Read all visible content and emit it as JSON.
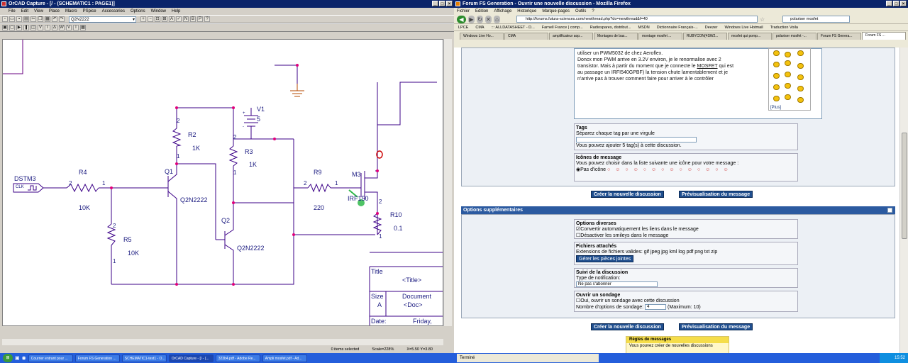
{
  "orcad": {
    "title": "OrCAD Capture - [/ - (SCHEMATIC1 : PAGE1)]",
    "menu": [
      "File",
      "Edit",
      "View",
      "Place",
      "Macro",
      "PSpice",
      "Accessories",
      "Options",
      "Window",
      "Help"
    ],
    "part_selector": "Q2N2222",
    "status": {
      "items": "0 items selected",
      "scale": "Scale=228%",
      "coords": "X=5.50  Y=3.80"
    },
    "schematic": {
      "labels": {
        "dstm3": "DSTM3",
        "clk": "CLK",
        "r4": "R4",
        "r4_val": "10K",
        "r5": "R5",
        "r5_val": "10K",
        "r2": "R2",
        "r2_val": "1K",
        "r3": "R3",
        "r3_val": "1K",
        "r9": "R9",
        "r9_val": "220",
        "r10": "R10",
        "r10_val": "0.1",
        "q1": "Q1",
        "q1_part": "Q2N2222",
        "q2": "Q2",
        "q2_part": "Q2N2222",
        "m3": "M3",
        "m3_part": "IRF150",
        "v1": "V1",
        "v1_val": "5",
        "pin1": "1",
        "pin2": "2",
        "plus": "+",
        "minus": "-"
      },
      "titleblock": {
        "title_label": "Title",
        "title_val": "<Title>",
        "size_label": "Size",
        "size_val": "A",
        "doc_label": "Document",
        "doc_val": "<Doc>",
        "date_label": "Date:",
        "date_val": "Friday,"
      }
    }
  },
  "firefox": {
    "title": "Forum FS Generation - Ouvrir une nouvelle discussion - Mozilla Firefox",
    "menu": [
      "Fichier",
      "Edition",
      "Affichage",
      "Historique",
      "Marque-pages",
      "Outils",
      "?"
    ],
    "url": "http://forums.futura-sciences.com/newthread.php?do=newthread&f=40",
    "search": "polariser mosfet",
    "bookmarks": [
      "LPCE",
      "CMA",
      "::: ALLDATASHEET - D...",
      "Farnell France | comp...",
      "Radiospares, distribut...",
      "MSDN",
      "Dictionnaire Français-...",
      "Deezer",
      "Windows Live Hotmail",
      "Traduction Voila"
    ],
    "tabs": [
      "Windows Live Ho...",
      "CMA",
      "amplificateur aop...",
      "Montages de bas...",
      "montage mosfet ...",
      "RUBYCON(4SW2...",
      "mosfet qui pomp...",
      "polariser mosfet -...",
      "Forum FS Genera...",
      "Forum FS ..."
    ],
    "message": {
      "line1": "utiliser un PWM5032 de chez Aeroflex.",
      "line2": "Doncx mon PWM arrive en 3.2V environ, je le renormalise avec 2",
      "line3": "transistor. Mais à partir du moment que je connecte le",
      "mosfet": "MOSFET",
      "line3b": " qui est",
      "line4": "au passage un IRFI540GPBF) la tension chute lamentablement et je",
      "line5": "n'arrive pas à trouver comment faire pour arriver à le contrôler"
    },
    "smilies_more": "[Plus]",
    "tags": {
      "legend": "Tags",
      "hint": "Séparez chaque tag par une virgule",
      "note": "Vous pouvez ajouter 5 tag(s) à cette discussion."
    },
    "icons": {
      "legend": "Icônes de message",
      "hint": "Vous pouvez choisir dans la liste suivante une icône pour votre message :",
      "none": "Pas d'icône"
    },
    "btn_create": "Créer la nouvelle discussion",
    "btn_preview": "Prévisualisation du message",
    "options_header": "Options supplémentaires",
    "diverses": {
      "legend": "Options diverses",
      "opt1": "Convertir automatiquement les liens dans le message",
      "opt2": "Désactiver les smileys dans le message"
    },
    "attach": {
      "legend": "Fichiers attachés",
      "ext": "Extensions de fichiers valides: gif jpeg jpg kml log pdf png txt zip",
      "btn": "Gérer les pièces jointes"
    },
    "suivi": {
      "legend": "Suivi de la discussion",
      "type": "Type de notification:",
      "select": "Ne pas s'abonner"
    },
    "sondage": {
      "legend": "Ouvrir un sondage",
      "opt": "Oui, ouvrir un sondage avec cette discussion",
      "count_label": "Nombre d'options de sondage:",
      "count": "4",
      "max": "(Maximum: 10)"
    },
    "rules": {
      "header": "Règles de messages",
      "text": "Vous pouvez créer de nouvelles discussions"
    },
    "status": "Terminé"
  },
  "taskbar": {
    "items": [
      "Courrier entrant pour ...",
      "Forum FS Generation ...",
      "SCHEMATIC1-test1 - O...",
      "OrCAD Capture - [/ - (...",
      "323b4.pdf - Adobe Re...",
      "Ampli mosfet.pdf - Ad..."
    ],
    "clock": "15:52"
  },
  "colors": {
    "wire": "#3b0087",
    "node": "#e0007a",
    "ff_button": "#1f4e8e",
    "section": "#2b5aa0"
  }
}
